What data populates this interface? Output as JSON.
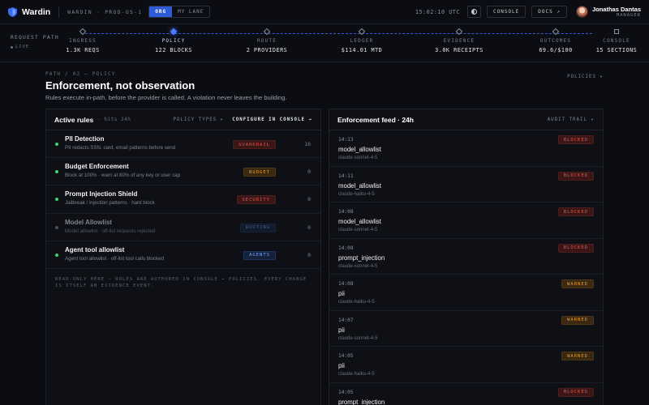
{
  "app": {
    "name": "Wardin",
    "workspace": "WARDIN · PROD-US-1"
  },
  "header": {
    "scope_tabs": [
      "ORG",
      "MY LANE"
    ],
    "active_scope": "ORG",
    "clock": "15:02:10 UTC",
    "console_label": "CONSOLE",
    "docs_label": "DOCS ↗",
    "user": {
      "name": "Jonathas Dantas",
      "role": "MANAGER"
    }
  },
  "request_path": {
    "label": "REQUEST PATH",
    "live": "LIVE",
    "stages": [
      {
        "label": "INGRESS",
        "value": "1.3K REQS"
      },
      {
        "label": "POLICY",
        "value": "122 BLOCKS",
        "active": true
      },
      {
        "label": "ROUTE",
        "value": "2 PROVIDERS"
      },
      {
        "label": "LEDGER",
        "value": "$114.01 MTD"
      },
      {
        "label": "EVIDENCE",
        "value": "3.0K RECEIPTS"
      },
      {
        "label": "OUTCOMES",
        "value": "69.6/$100"
      },
      {
        "label": "CONSOLE",
        "value": "15 SECTIONS"
      }
    ]
  },
  "page": {
    "breadcrumb": "PATH / 02 — POLICY",
    "title": "Enforcement, not observation",
    "subtitle": "Rules execute in-path, before the provider is called. A violation never leaves the building.",
    "policies_link": "POLICIES ▸"
  },
  "rules_panel": {
    "title": "Active rules",
    "subtitle": "· hits 24h",
    "policy_types": "POLICY TYPES ▸",
    "configure": "CONFIGURE IN CONSOLE →",
    "rules": [
      {
        "name": "PII Detection",
        "desc": "PII redacts SSN, card, email patterns before send",
        "badge": "GUARDRAIL",
        "count": "16",
        "enabled": true
      },
      {
        "name": "Budget Enforcement",
        "desc": "Block at 100% · warn at 80% of any key or user cap",
        "badge": "BUDGET",
        "count": "0",
        "enabled": true
      },
      {
        "name": "Prompt Injection Shield",
        "desc": "Jailbreak / injection patterns · hard block",
        "badge": "SECURITY",
        "count": "0",
        "enabled": true
      },
      {
        "name": "Model Allowlist",
        "desc": "Model allowlist · off-list requests rejected",
        "badge": "ROUTING",
        "count": "0",
        "enabled": false
      },
      {
        "name": "Agent tool allowlist",
        "desc": "Agent tool allowlist · off-list tool calls blocked",
        "badge": "AGENTS",
        "count": "0",
        "enabled": true
      }
    ],
    "footnote": "READ-ONLY HERE — RULES ARE AUTHORED IN CONSOLE → POLICIES. EVERY CHANGE IS ITSELF AN EVIDENCE EVENT."
  },
  "feed_panel": {
    "title": "Enforcement feed · 24h",
    "audit_link": "AUDIT TRAIL ▸",
    "events": [
      {
        "time": "14:13",
        "rule": "model_allowlist",
        "model": "claude-sonnet-4-5",
        "status": "BLOCKED"
      },
      {
        "time": "14:11",
        "rule": "model_allowlist",
        "model": "claude-haiku-4-5",
        "status": "BLOCKED"
      },
      {
        "time": "14:08",
        "rule": "model_allowlist",
        "model": "claude-sonnet-4-5",
        "status": "BLOCKED"
      },
      {
        "time": "14:08",
        "rule": "prompt_injection",
        "model": "claude-sonnet-4-5",
        "status": "BLOCKED"
      },
      {
        "time": "14:08",
        "rule": "pii",
        "model": "claude-haiku-4-5",
        "status": "WARNED"
      },
      {
        "time": "14:07",
        "rule": "pii",
        "model": "claude-sonnet-4-5",
        "status": "WARNED"
      },
      {
        "time": "14:05",
        "rule": "pii",
        "model": "claude-haiku-4-5",
        "status": "WARNED"
      },
      {
        "time": "14:05",
        "rule": "prompt_injection",
        "model": "",
        "status": "BLOCKED"
      }
    ]
  },
  "colors": {
    "accent": "#2f5bd8",
    "ok": "#3ecf74",
    "danger": "#e0574f",
    "warn": "#e59a38"
  }
}
